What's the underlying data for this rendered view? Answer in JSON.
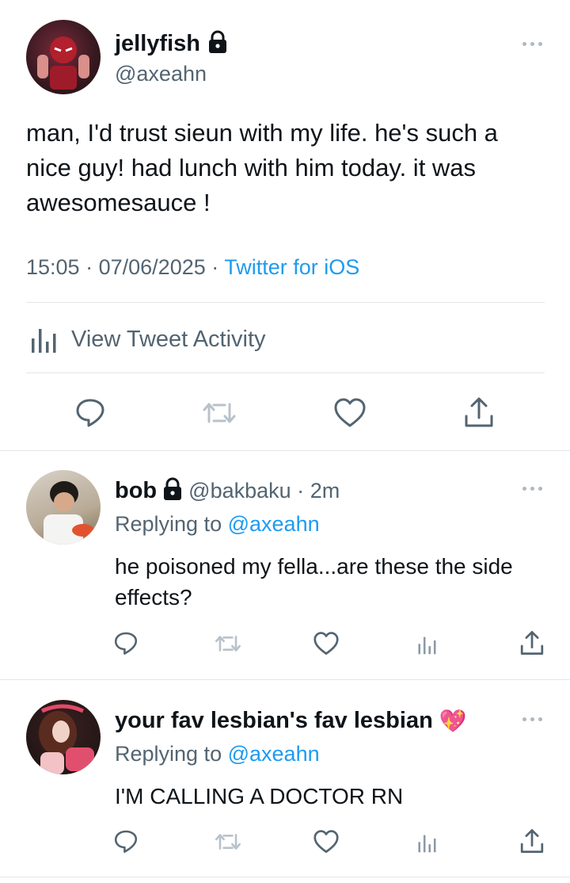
{
  "main_tweet": {
    "display_name": "jellyfish",
    "handle": "@axeahn",
    "text": "man, I'd trust sieun with my life. he's such a nice guy! had lunch with him today. it was awesomesauce !",
    "time": "15:05",
    "date": "07/06/2025",
    "source": "Twitter for iOS",
    "separator": "·",
    "activity_label": "View Tweet Activity"
  },
  "replies": [
    {
      "display_name": "bob",
      "handle": "@bakbaku",
      "age": "2m",
      "replying_prefix": "Replying to",
      "replying_handle": "@axeahn",
      "text": "he poisoned my fella...are these the side effects?"
    },
    {
      "display_name": "your fav lesbian's fav lesbian",
      "emoji": "💖",
      "replying_prefix": "Replying to",
      "replying_handle": "@axeahn",
      "text": "I'M CALLING A DOCTOR RN"
    }
  ],
  "icons": {
    "reply": "reply-icon",
    "retweet": "retweet-icon",
    "like": "heart-icon",
    "share": "share-icon",
    "analytics": "analytics-icon",
    "more": "more-icon",
    "lock": "lock-icon"
  },
  "colors": {
    "accent": "#1d9bf0",
    "text": "#0f1419",
    "secondary": "#536471",
    "icon_light": "#8b98a5"
  }
}
